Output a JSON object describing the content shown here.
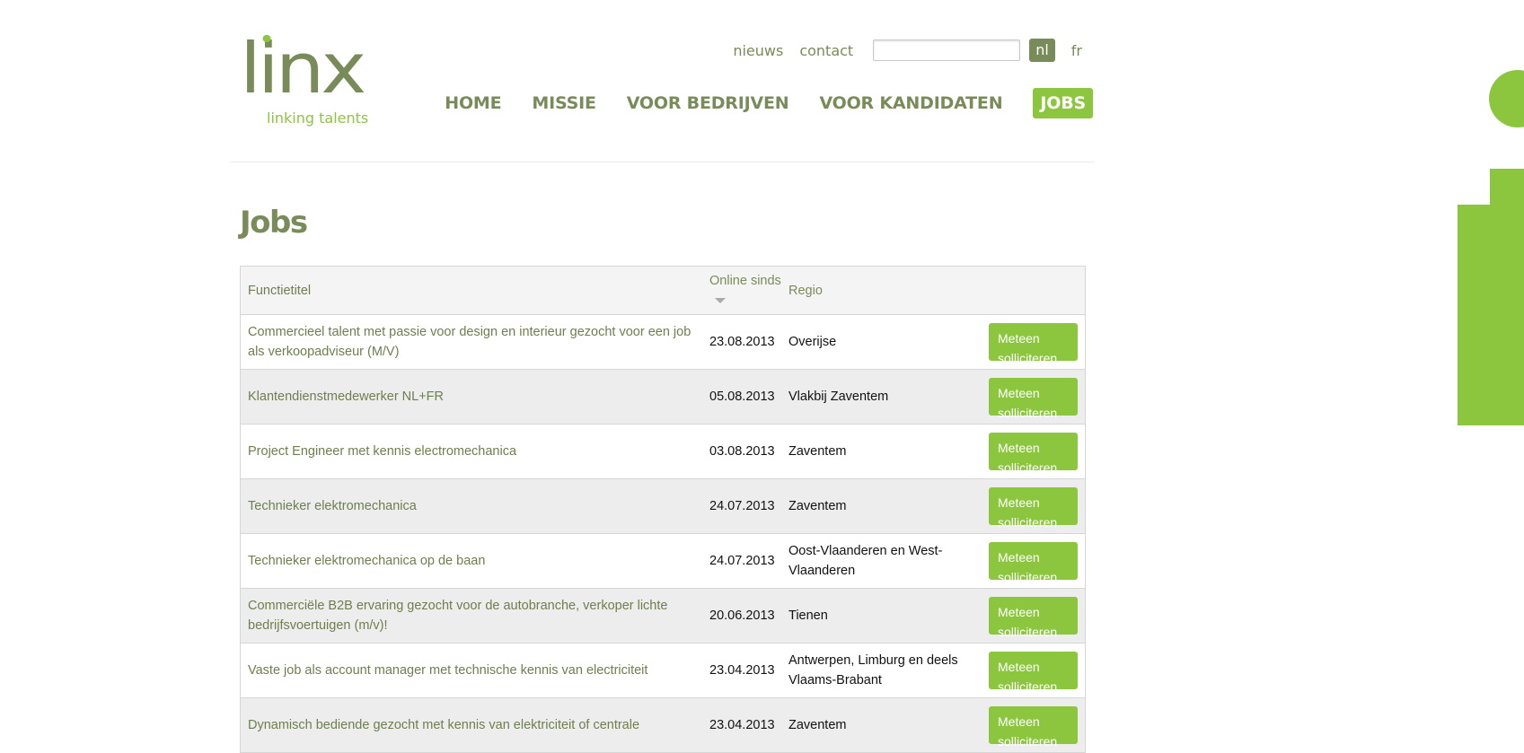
{
  "logo": {
    "word_l": "l",
    "word_i": "i",
    "word_nx": "nx",
    "tagline": "linking talents"
  },
  "util": {
    "news": "nieuws",
    "contact": "contact",
    "search_placeholder": "",
    "lang_nl": "nl",
    "lang_fr": "fr"
  },
  "nav": {
    "home": "HOME",
    "missie": "MISSIE",
    "bedrijven": "VOOR BEDRIJVEN",
    "kandidaten": "VOOR KANDIDATEN",
    "jobs": "JOBS"
  },
  "page_title": "Jobs",
  "table": {
    "headers": {
      "title": "Functietitel",
      "date": "Online sinds",
      "region": "Regio"
    },
    "apply_label": "Meteen solliciteren",
    "rows": [
      {
        "title": "Commercieel talent met passie voor design en interieur gezocht voor een job als verkoopadviseur (M/V)",
        "date": "23.08.2013",
        "region": "Overijse"
      },
      {
        "title": "Klantendienstmedewerker NL+FR",
        "date": "05.08.2013",
        "region": "Vlakbij Zaventem"
      },
      {
        "title": "Project Engineer met kennis electromechanica",
        "date": "03.08.2013",
        "region": "Zaventem"
      },
      {
        "title": "Technieker elektromechanica",
        "date": "24.07.2013",
        "region": "Zaventem"
      },
      {
        "title": "Technieker elektromechanica op de baan",
        "date": "24.07.2013",
        "region": "Oost-Vlaanderen en West-Vlaanderen"
      },
      {
        "title": "Commerciële B2B ervaring gezocht voor de autobranche, verkoper lichte bedrijfsvoertuigen (m/v)!",
        "date": "20.06.2013",
        "region": "Tienen"
      },
      {
        "title": "Vaste job als account manager met technische kennis van electriciteit",
        "date": "23.04.2013",
        "region": "Antwerpen, Limburg en deels Vlaams-Brabant"
      },
      {
        "title": "Dynamisch bediende gezocht met kennis van elektriciteit of centrale",
        "date": "23.04.2013",
        "region": "Zaventem"
      }
    ]
  },
  "colors": {
    "brand_olive": "#7a8b5a",
    "brand_green": "#8cc63f"
  }
}
